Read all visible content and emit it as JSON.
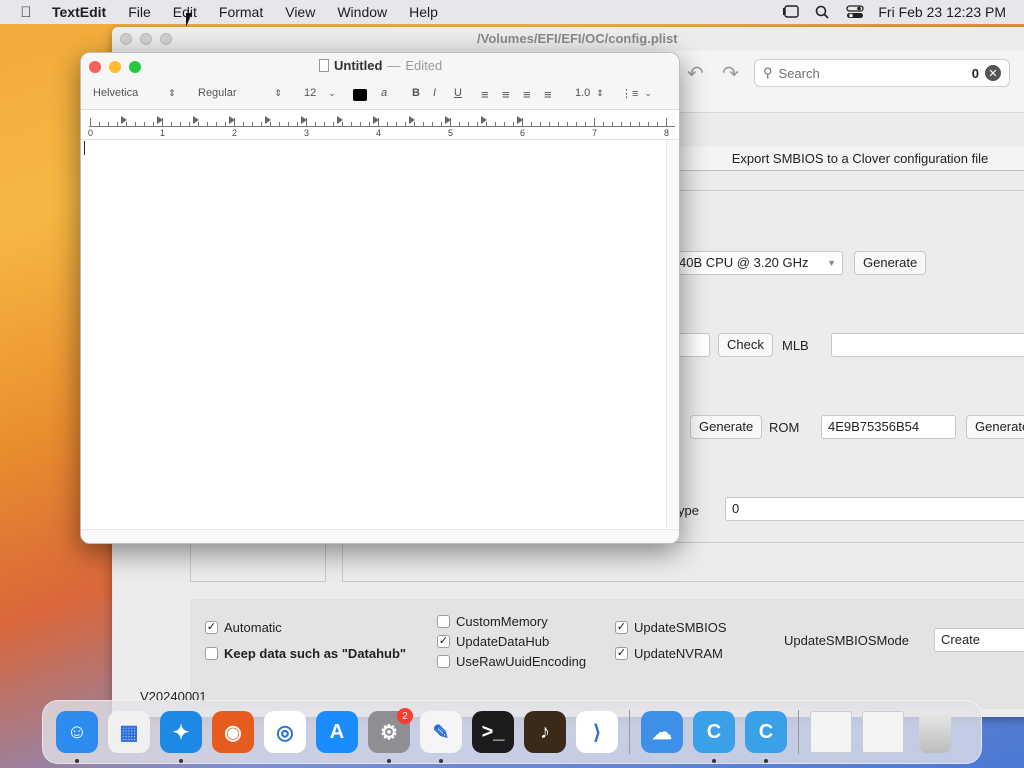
{
  "menubar": {
    "app": "TextEdit",
    "items": [
      "File",
      "Edit",
      "Format",
      "View",
      "Window",
      "Help"
    ],
    "clock": "Fri Feb 23  12:23 PM"
  },
  "bgwindow": {
    "title": "/Volumes/EFI/EFI/OC/config.plist",
    "search": {
      "placeholder": "Search",
      "count": "0"
    },
    "export_button": "Export SMBIOS to a Clover configuration file",
    "cpu_select": "40B CPU @ 3.20 GHz",
    "generate_label": "Generate",
    "check_label": "Check",
    "mlb_label": "MLB",
    "mlb_value": "",
    "rom_label": "ROM",
    "rom_value": "4E9B75356B54",
    "type_label": "ype",
    "type_value": "0",
    "checkboxes": [
      {
        "label": "Automatic",
        "checked": "✓"
      },
      {
        "label": "Keep data such as \"Datahub\"",
        "checked": ""
      },
      {
        "label": "CustomMemory",
        "checked": ""
      },
      {
        "label": "UpdateDataHub",
        "checked": "✓"
      },
      {
        "label": "UseRawUuidEncoding",
        "checked": ""
      },
      {
        "label": "UpdateSMBIOS",
        "checked": "✓"
      },
      {
        "label": "UpdateNVRAM",
        "checked": "✓"
      }
    ],
    "smbios_mode_label": "UpdateSMBIOSMode",
    "smbios_mode_value": "Create",
    "version": "V20240001"
  },
  "textedit": {
    "title": "Untitled",
    "edited": "Edited",
    "font": "Helvetica",
    "style": "Regular",
    "size": "12",
    "line_spacing": "1.0",
    "ruler_numbers": [
      "0",
      "1",
      "2",
      "3",
      "4",
      "5",
      "6",
      "7",
      "8"
    ]
  },
  "dock": {
    "apps": [
      {
        "name": "finder-icon",
        "color": "#2d8cf0",
        "glyph": "☺",
        "running": true
      },
      {
        "name": "launchpad-icon",
        "color": "#f0f0f0",
        "glyph": "▦",
        "running": false
      },
      {
        "name": "safari-icon",
        "color": "#1e88e5",
        "glyph": "✦",
        "running": true
      },
      {
        "name": "firefox-icon",
        "color": "#e65c1f",
        "glyph": "◉",
        "running": false
      },
      {
        "name": "chrome-icon",
        "color": "#ffffff",
        "glyph": "◎",
        "running": false
      },
      {
        "name": "app-store-icon",
        "color": "#1a8cff",
        "glyph": "A",
        "running": false
      },
      {
        "name": "system-settings-icon",
        "color": "#8e8e93",
        "glyph": "⚙",
        "running": true,
        "badge": "2"
      },
      {
        "name": "textedit-icon",
        "color": "#f5f5f5",
        "glyph": "✎",
        "running": true
      },
      {
        "name": "terminal-icon",
        "color": "#1c1c1e",
        "glyph": ">_",
        "running": false
      },
      {
        "name": "garageband-icon",
        "color": "#3a2a1a",
        "glyph": "♪",
        "running": false
      },
      {
        "name": "vscode-icon",
        "color": "#ffffff",
        "glyph": "⟩",
        "running": false
      }
    ],
    "apps2": [
      {
        "name": "weather-icon",
        "color": "#3d8fe8",
        "glyph": "☁",
        "running": false
      },
      {
        "name": "opencore-config-icon",
        "color": "#3aa0e8",
        "glyph": "C",
        "running": true
      },
      {
        "name": "opencore-config2-icon",
        "color": "#3aa0e8",
        "glyph": "C",
        "running": true
      }
    ],
    "colors": {
      "dock_bg": "#e1e1e8"
    }
  }
}
